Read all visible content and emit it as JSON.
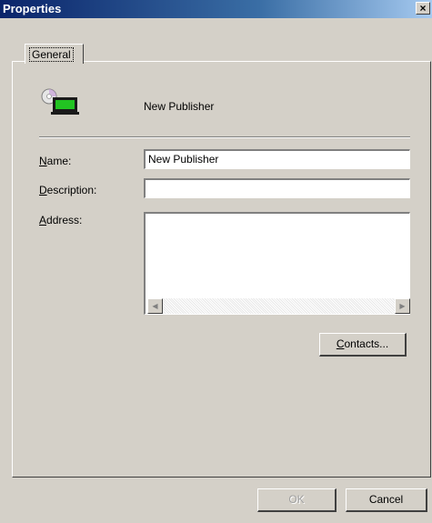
{
  "window": {
    "title": "Properties",
    "close_glyph": "×"
  },
  "tabs": [
    {
      "label": "General"
    }
  ],
  "publisher": {
    "display_name": "New Publisher",
    "icon": "publisher-computer-icon"
  },
  "form": {
    "name": {
      "label_prefix": "N",
      "label_rest": "ame:",
      "value": "New Publisher"
    },
    "description": {
      "label_prefix": "D",
      "label_rest": "escription:",
      "value": ""
    },
    "address": {
      "label_prefix": "A",
      "label_rest": "ddress:",
      "value": ""
    }
  },
  "scrollbar": {
    "left_glyph": "◀",
    "right_glyph": "▶"
  },
  "buttons": {
    "contacts_prefix": "C",
    "contacts_rest": "ontacts...",
    "ok": "OK",
    "cancel": "Cancel"
  },
  "colors": {
    "titlebar": "#0a246a",
    "dialog_bg": "#d4d0c8",
    "screen_icon": "#22c322"
  }
}
